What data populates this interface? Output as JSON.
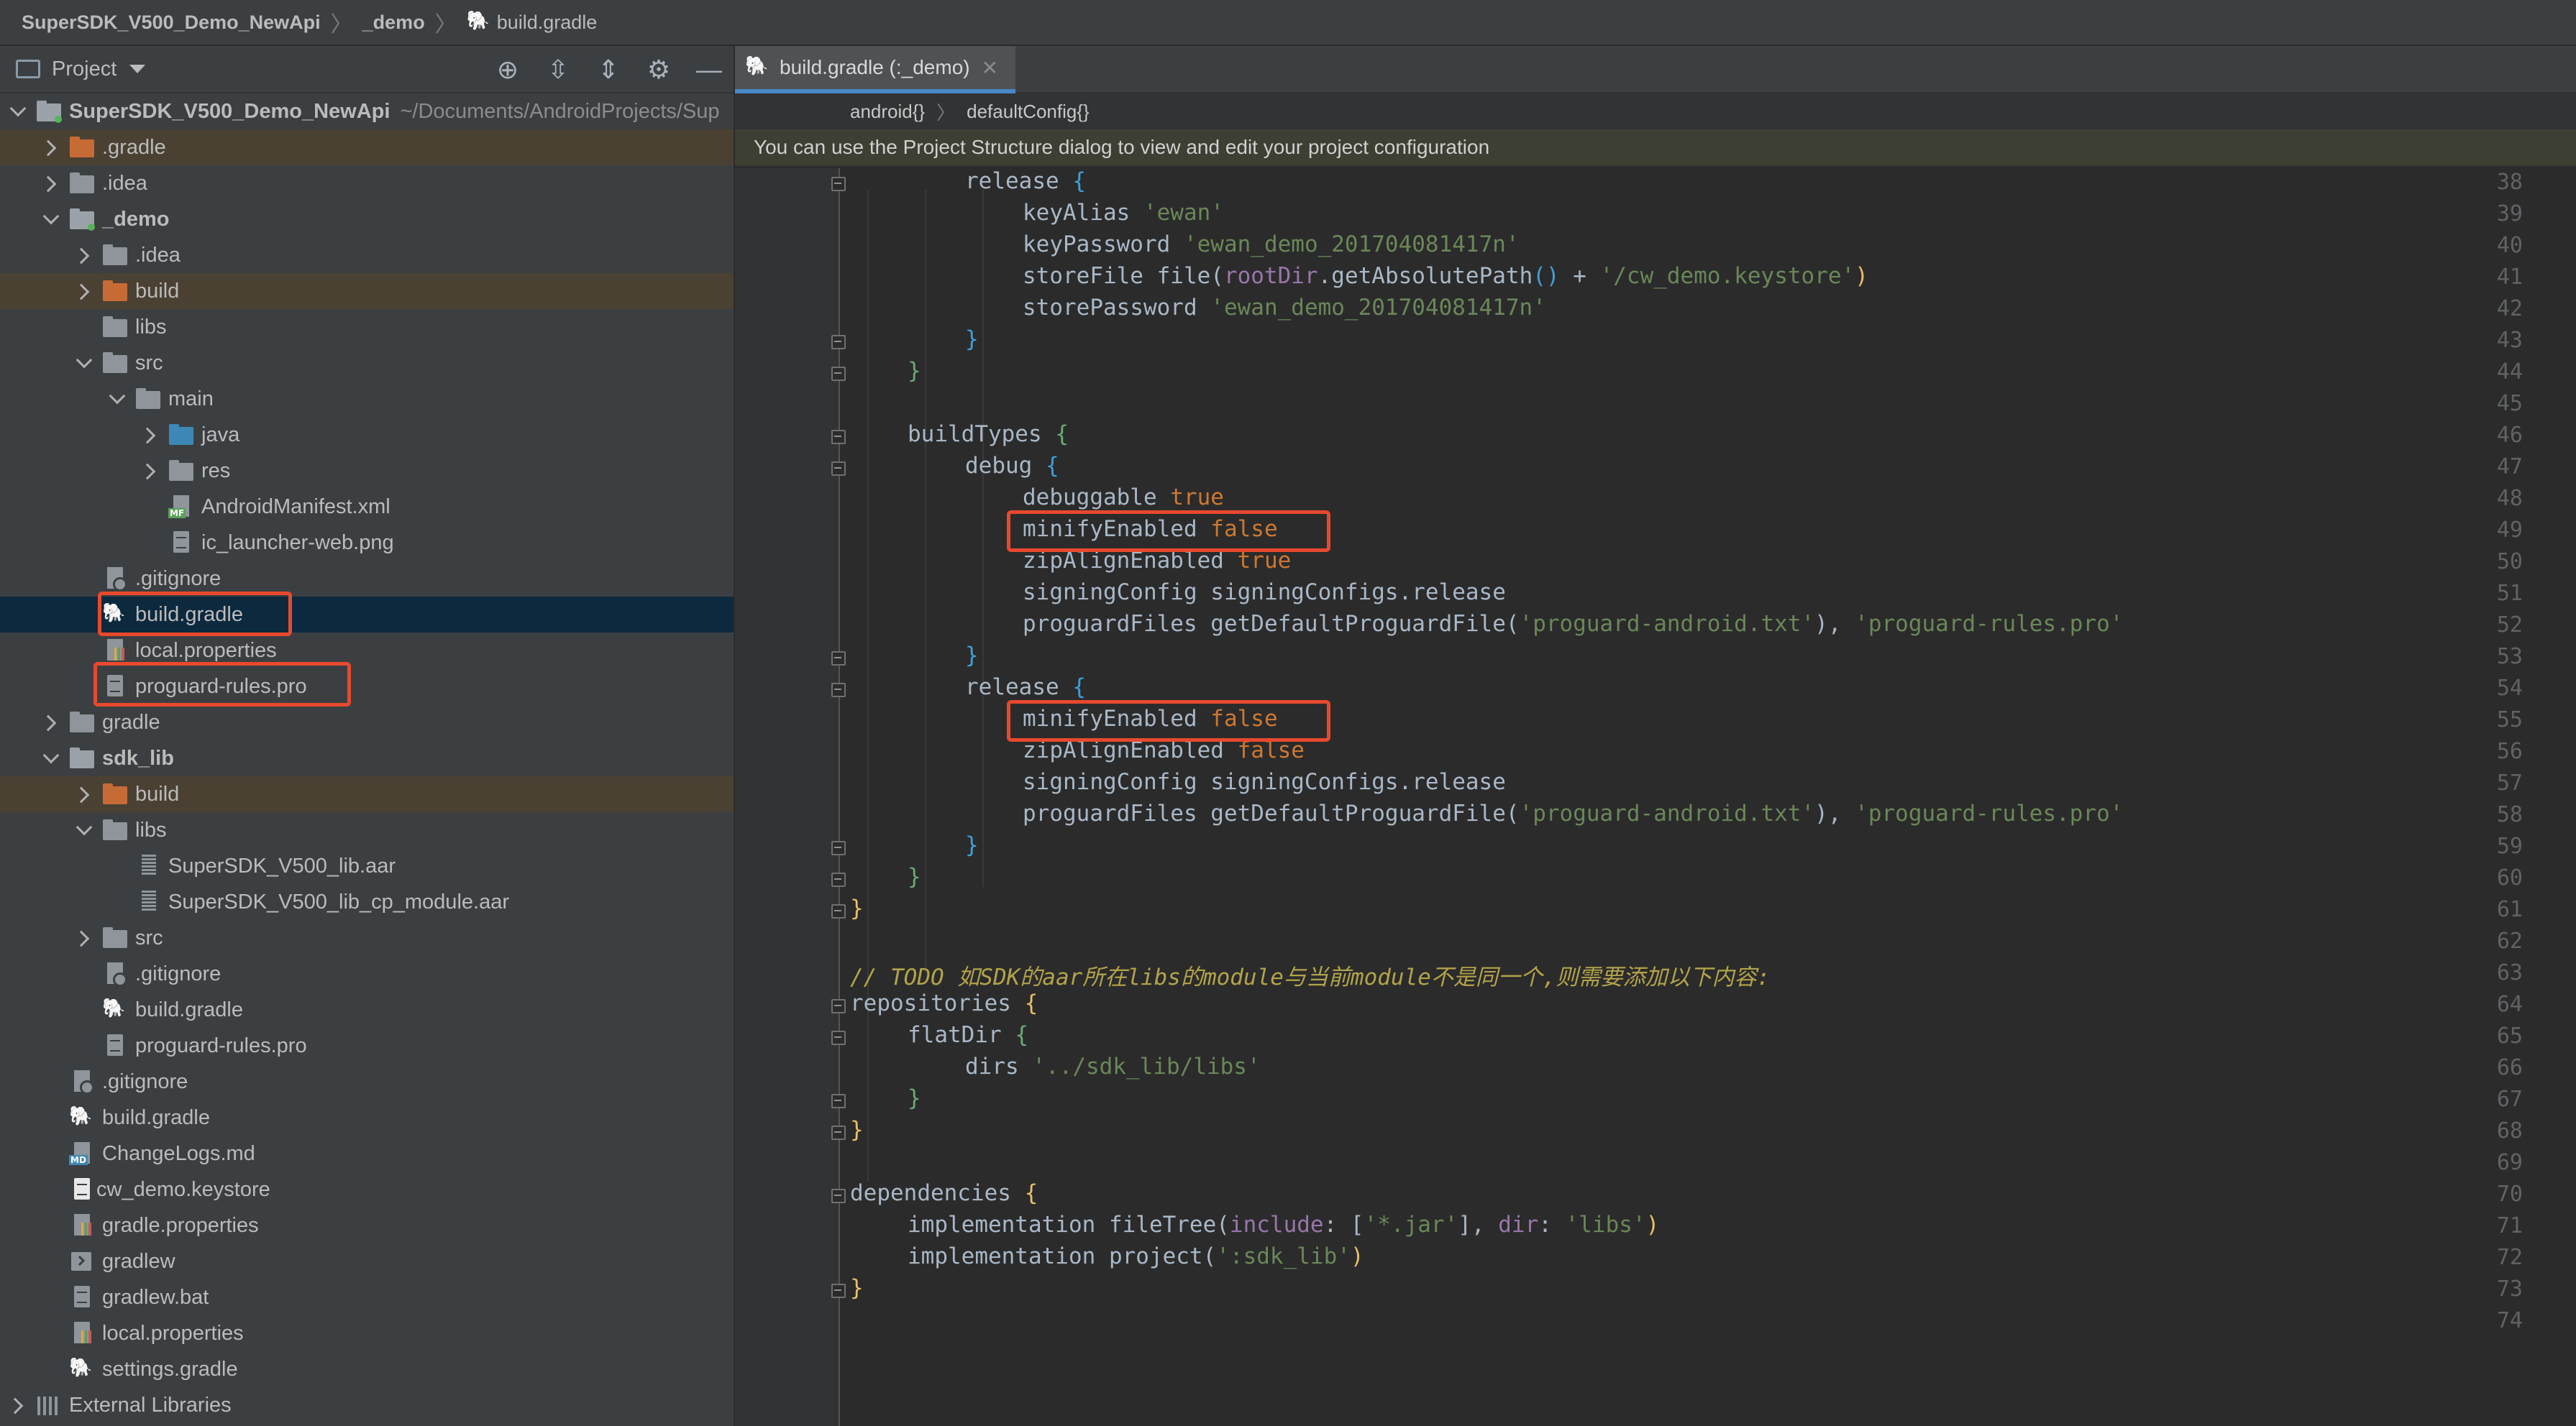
{
  "breadcrumb": [
    "SuperSDK_V500_Demo_NewApi",
    "_demo",
    "build.gradle"
  ],
  "project_panel": {
    "title": "Project",
    "tools": [
      "crosshair-icon",
      "expand-all-icon",
      "collapse-all-icon",
      "gear-icon",
      "minimize-icon"
    ],
    "root_label": "SuperSDK_V500_Demo_NewApi",
    "root_path": "~/Documents/AndroidProjects/Sup",
    "items": [
      ".gradle",
      ".idea",
      "_demo",
      ".idea",
      "build",
      "libs",
      "src",
      "main",
      "java",
      "res",
      "AndroidManifest.xml",
      "ic_launcher-web.png",
      ".gitignore",
      "build.gradle",
      "local.properties",
      "proguard-rules.pro",
      "gradle",
      "sdk_lib",
      "build",
      "libs",
      "SuperSDK_V500_lib.aar",
      "SuperSDK_V500_lib_cp_module.aar",
      "src",
      ".gitignore",
      "build.gradle",
      "proguard-rules.pro",
      ".gitignore",
      "build.gradle",
      "ChangeLogs.md",
      "cw_demo.keystore",
      "gradle.properties",
      "gradlew",
      "gradlew.bat",
      "local.properties",
      "settings.gradle",
      "External Libraries"
    ]
  },
  "editor": {
    "tab_label": "build.gradle (:_demo)",
    "crumbs": [
      "android{}",
      "defaultConfig{}"
    ],
    "banner": "You can use the Project Structure dialog to view and edit your project configuration",
    "line_numbers": [
      "38",
      "39",
      "40",
      "41",
      "42",
      "43",
      "44",
      "45",
      "46",
      "47",
      "48",
      "49",
      "50",
      "51",
      "52",
      "53",
      "54",
      "55",
      "56",
      "57",
      "58",
      "59",
      "60",
      "61",
      "62",
      "63",
      "64",
      "65",
      "66",
      "67",
      "68",
      "69",
      "70",
      "71",
      "72",
      "73",
      "74"
    ],
    "code": {
      "l38": [
        "release ",
        "{"
      ],
      "l39": [
        "keyAlias ",
        "'ewan'"
      ],
      "l40": [
        "keyPassword ",
        "'ewan_demo_201704081417n'"
      ],
      "l41": [
        "storeFile file(",
        "rootDir",
        ".getAbsolutePath",
        "()",
        " + ",
        "'/cw_demo.keystore'",
        ")"
      ],
      "l42": [
        "storePassword ",
        "'ewan_demo_201704081417n'"
      ],
      "l43": [
        "}"
      ],
      "l44": [
        "}"
      ],
      "l46": [
        "buildTypes ",
        "{"
      ],
      "l47": [
        "debug ",
        "{"
      ],
      "l48": [
        "debuggable ",
        "true"
      ],
      "l49": [
        "minifyEnabled ",
        "false"
      ],
      "l50": [
        "zipAlignEnabled ",
        "true"
      ],
      "l51": [
        "signingConfig signingConfigs.release"
      ],
      "l52": [
        "proguardFiles getDefaultProguardFile(",
        "'proguard-android.txt'",
        "), ",
        "'proguard-rules.pro'"
      ],
      "l53": [
        "}"
      ],
      "l54": [
        "release ",
        "{"
      ],
      "l55": [
        "minifyEnabled ",
        "false"
      ],
      "l56": [
        "zipAlignEnabled ",
        "false"
      ],
      "l57": [
        "signingConfig signingConfigs.release"
      ],
      "l58": [
        "proguardFiles getDefaultProguardFile(",
        "'proguard-android.txt'",
        "), ",
        "'proguard-rules.pro'"
      ],
      "l59": [
        "}"
      ],
      "l60": [
        "}"
      ],
      "l61": [
        "}"
      ],
      "l63": [
        "// TODO 如SDK的aar所在libs的module与当前module不是同一个,则需要添加以下内容:"
      ],
      "l64": [
        "repositories ",
        "{"
      ],
      "l65": [
        "flatDir ",
        "{"
      ],
      "l66": [
        "dirs ",
        "'../sdk_lib/libs'"
      ],
      "l67": [
        "}"
      ],
      "l68": [
        "}"
      ],
      "l70": [
        "dependencies ",
        "{"
      ],
      "l71": [
        "implementation fileTree(",
        "include",
        ": [",
        "'*.jar'",
        "], ",
        "dir",
        ": ",
        "'libs'",
        ")"
      ],
      "l72": [
        "implementation project(",
        "':sdk_lib'",
        ")"
      ],
      "l73": [
        "}"
      ]
    }
  },
  "colors": {
    "highlight_box": "#e8492e",
    "keyword": "#cc7832",
    "string": "#6a8759",
    "comment": "#b2a34a",
    "field": "#9876aa"
  }
}
